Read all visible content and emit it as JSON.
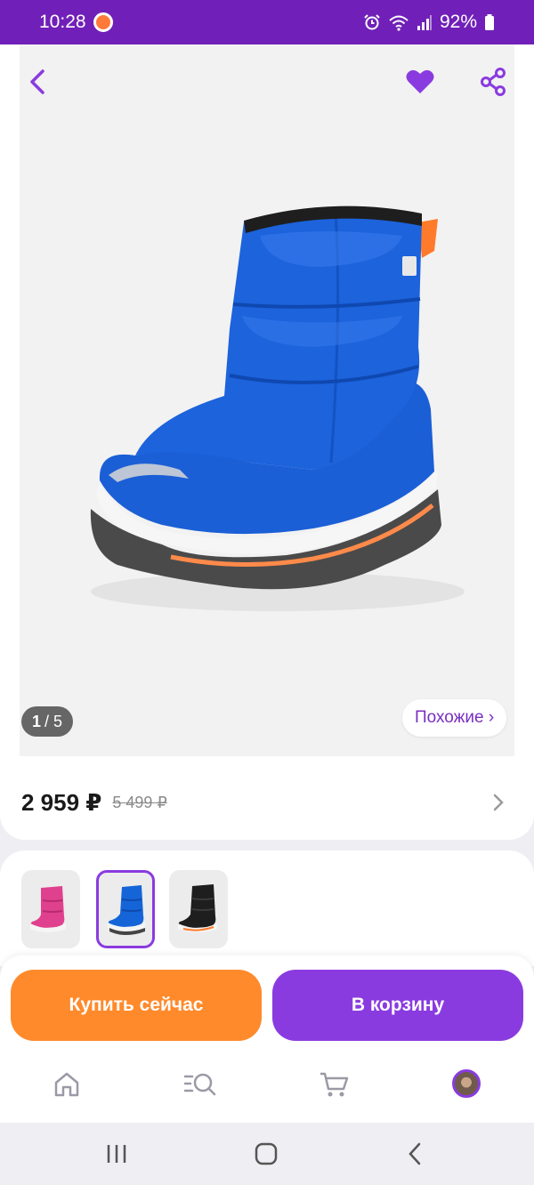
{
  "status_bar": {
    "time": "10:28",
    "battery": "92%"
  },
  "gallery": {
    "counter_current": "1",
    "counter_separator": "/ 5",
    "similar_label": "Похожие ›"
  },
  "price": {
    "current": "2 959 ₽",
    "old": "5 499 ₽"
  },
  "variants": [
    {
      "color": "#e0418e",
      "selected": false
    },
    {
      "color": "#1565d8",
      "selected": true
    },
    {
      "color": "#1e1e1e",
      "selected": false
    }
  ],
  "actions": {
    "buy_now": "Купить сейчас",
    "add_to_cart": "В корзину"
  },
  "tabs": [
    "home-icon",
    "catalog-search-icon",
    "cart-icon",
    "profile-avatar"
  ],
  "colors": {
    "brand_purple": "#7020b8",
    "accent_purple": "#8a3be0",
    "accent_orange": "#ff8a2b",
    "boot_blue": "#1565d8"
  }
}
